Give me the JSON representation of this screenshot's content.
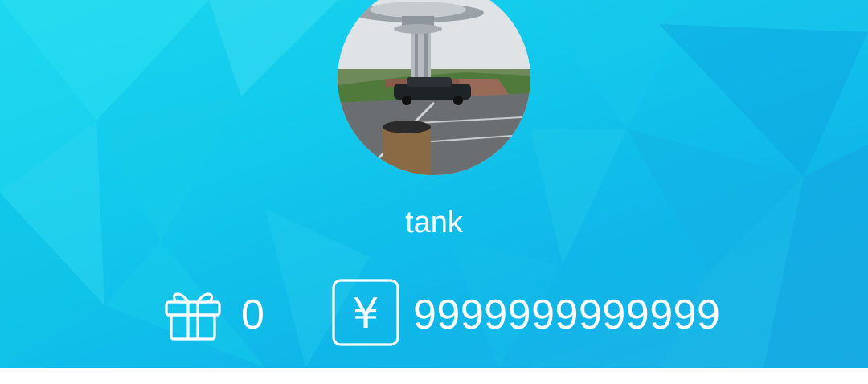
{
  "profile": {
    "username": "tank",
    "avatar_alt": "profile-photo"
  },
  "stats": {
    "gifts": {
      "icon": "gift-icon",
      "value": "0"
    },
    "coins": {
      "icon": "yuan-icon",
      "symbol": "¥",
      "value": "9999999999999"
    }
  },
  "colors": {
    "header_background": "#12c9ec",
    "text": "#ffffff"
  }
}
